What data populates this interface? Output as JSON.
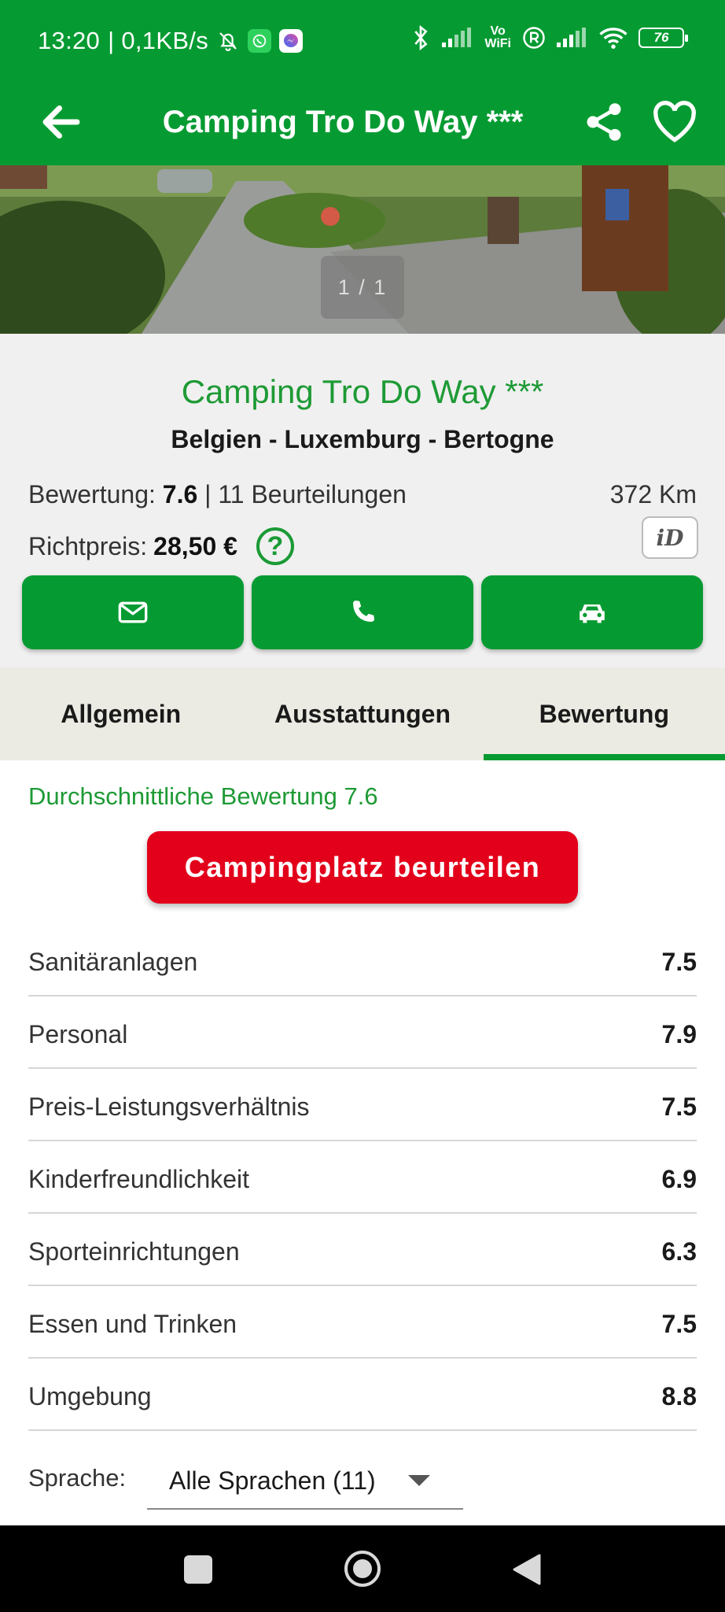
{
  "status_bar": {
    "time": "13:20",
    "speed": "| 0,1KB/s",
    "battery": "76",
    "vowifi_top": "Vo",
    "vowifi_bottom": "WiFi",
    "icons": [
      "bell-off-icon",
      "whatsapp-icon",
      "messenger-icon",
      "bluetooth-icon",
      "signal-icon",
      "vowifi-icon",
      "roaming-icon",
      "signal-icon",
      "wifi-icon",
      "battery-icon"
    ]
  },
  "app_bar": {
    "title": "Camping Tro Do Way ***",
    "icons": [
      "back-arrow-icon",
      "share-icon",
      "heart-icon"
    ]
  },
  "photo": {
    "counter": "1 / 1"
  },
  "info": {
    "name": "Camping Tro Do Way ***",
    "region": "Belgien  - Luxemburg - Bertogne",
    "rating_label": "Bewertung:",
    "rating_value": "7.6",
    "reviews": "| 11 Beurteilungen",
    "distance": "372 Km",
    "price_label": "Richtpreis:",
    "price_value": "28,50 €",
    "help": "?",
    "id_badge": "iD"
  },
  "actions": [
    "mail-icon",
    "phone-icon",
    "car-icon"
  ],
  "tabs": [
    {
      "label": "Allgemein",
      "active": false
    },
    {
      "label": "Ausstattungen",
      "active": false
    },
    {
      "label": "Bewertung",
      "active": true
    }
  ],
  "review": {
    "average": "Durchschnittliche Bewertung 7.6",
    "rate_button": "Campingplatz beurteilen",
    "criteria": [
      {
        "label": "Sanitäranlagen",
        "value": "7.5"
      },
      {
        "label": "Personal",
        "value": "7.9"
      },
      {
        "label": "Preis-Leistungsverhältnis",
        "value": "7.5"
      },
      {
        "label": "Kinderfreundlichkeit",
        "value": "6.9"
      },
      {
        "label": "Sporteinrichtungen",
        "value": "6.3"
      },
      {
        "label": "Essen und Trinken",
        "value": "7.5"
      },
      {
        "label": "Umgebung",
        "value": "8.8"
      }
    ],
    "language_label": "Sprache:",
    "language_value": "Alle Sprachen (11)"
  },
  "colors": {
    "primary": "#069b32",
    "accent_text": "#1e9a35",
    "cta": "#e3001b",
    "info_bg": "#f0f0f0",
    "tabs_bg": "#ebebe3"
  }
}
